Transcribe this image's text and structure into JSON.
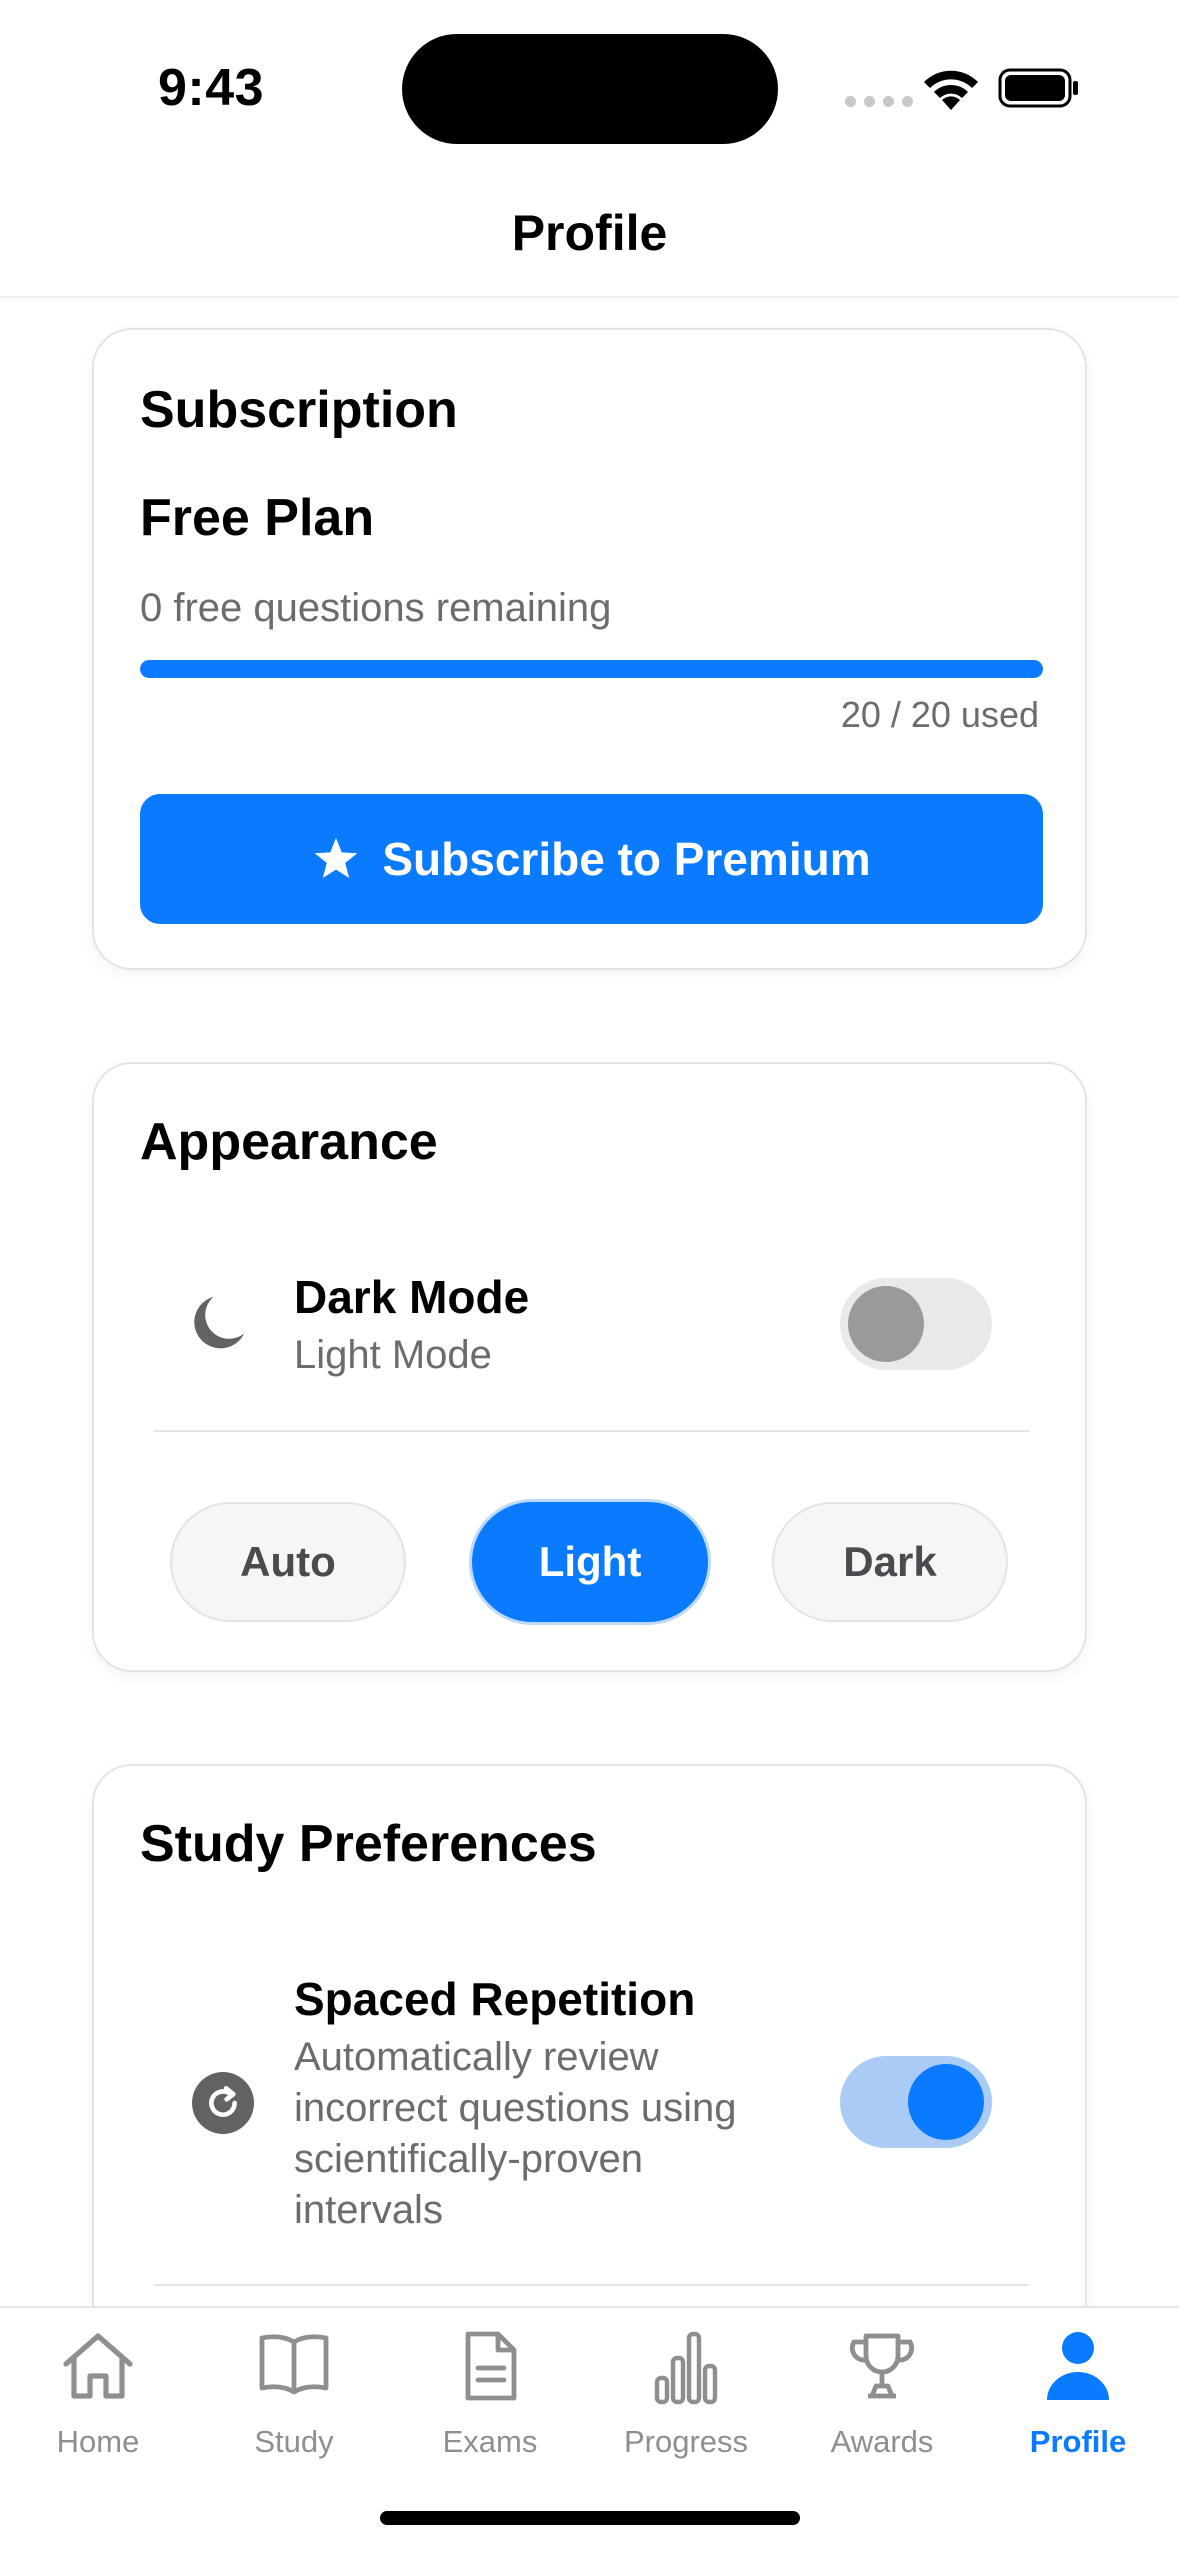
{
  "status_bar": {
    "time": "9:43"
  },
  "nav": {
    "title": "Profile"
  },
  "subscription": {
    "title": "Subscription",
    "plan": "Free Plan",
    "remaining": "0 free questions remaining",
    "used": "20 / 20 used",
    "usage_fraction": 1.0,
    "subscribe_label": "Subscribe to Premium"
  },
  "appearance": {
    "title": "Appearance",
    "dark_mode_title": "Dark Mode",
    "dark_mode_sub": "Light Mode",
    "dark_mode_on": false,
    "modes": [
      {
        "label": "Auto",
        "active": false
      },
      {
        "label": "Light",
        "active": true
      },
      {
        "label": "Dark",
        "active": false
      }
    ]
  },
  "study": {
    "title": "Study Preferences",
    "spaced_title": "Spaced Repetition",
    "spaced_sub_lines": [
      "Automatically review",
      "incorrect questions using",
      "scientifically-proven",
      "intervals"
    ],
    "spaced_on": true
  },
  "tabs": [
    {
      "label": "Home",
      "icon": "house-icon",
      "active": false
    },
    {
      "label": "Study",
      "icon": "book-icon",
      "active": false
    },
    {
      "label": "Exams",
      "icon": "document-icon",
      "active": false
    },
    {
      "label": "Progress",
      "icon": "bar-chart-icon",
      "active": false
    },
    {
      "label": "Awards",
      "icon": "trophy-icon",
      "active": false
    },
    {
      "label": "Profile",
      "icon": "person-icon",
      "active": true
    }
  ],
  "colors": {
    "accent": "#0a7aff",
    "secondary_text": "#6b6b70",
    "inactive_tab": "#8e8e93"
  }
}
